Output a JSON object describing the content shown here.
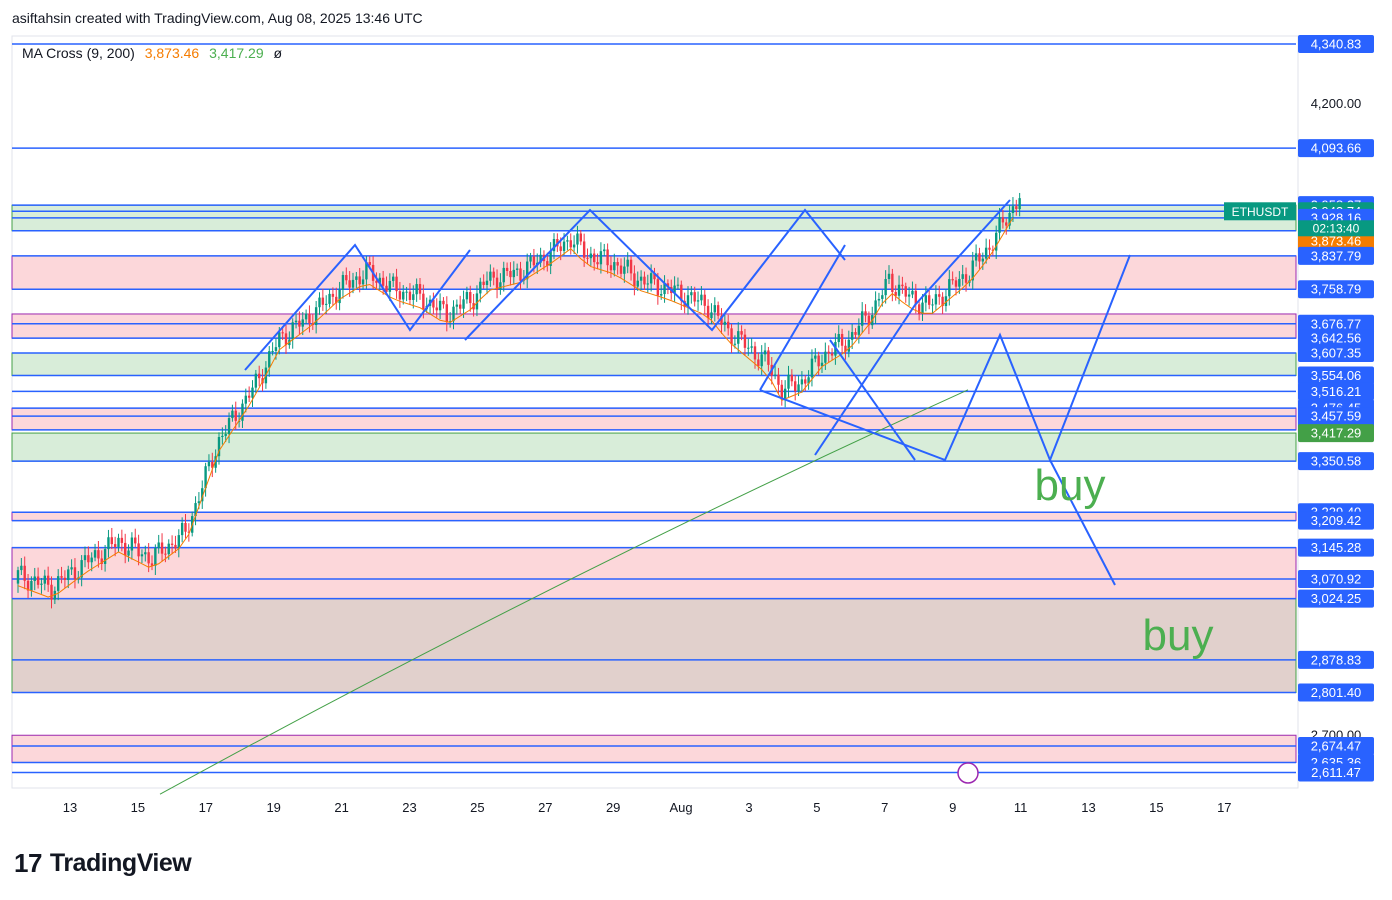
{
  "header": "asiftahsin created with TradingView.com, Aug 08, 2025 13:46 UTC",
  "indicator": {
    "name": "MA Cross (9, 200)",
    "fast": "3,873.46",
    "slow": "3,417.29",
    "eye": "ø"
  },
  "symbol": "ETHUSDT",
  "countdown": "02:13:40",
  "logo_text": "TradingView",
  "colors": {
    "up": "#089981",
    "down": "#f23645",
    "level_line": "#2962ff",
    "ma_fast": "#f57c00",
    "ma_slow": "#43a047",
    "buy_text": "#4caf50"
  },
  "chart_data": {
    "type": "candlestick",
    "y_axis_labels": [
      "4,340.83",
      "4,200.00",
      "4,093.66",
      "3,958.27",
      "3,943.74",
      "3,928.16",
      "3,897.47",
      "3,873.46",
      "3,837.79",
      "3,758.79",
      "3,676.77",
      "3,642.56",
      "3,607.35",
      "3,554.06",
      "3,516.21",
      "3,476.45",
      "3,457.59",
      "3,424.82",
      "3,417.29",
      "3,350.58",
      "3,229.40",
      "3,209.42",
      "3,145.28",
      "3,070.92",
      "3,024.25",
      "2,878.83",
      "2,801.40",
      "2,700.00",
      "2,674.47",
      "2,635.36",
      "2,611.47"
    ],
    "x_axis_labels": [
      "13",
      "15",
      "17",
      "19",
      "21",
      "23",
      "25",
      "27",
      "29",
      "Aug",
      "3",
      "5",
      "7",
      "9",
      "11",
      "13",
      "15",
      "17"
    ],
    "annotations": [
      "buy",
      "buy"
    ],
    "horizontal_levels": [
      4340.83,
      4093.66,
      3958.27,
      3943.74,
      3928.16,
      3897.47,
      3837.79,
      3758.79,
      3676.77,
      3642.56,
      3607.35,
      3554.06,
      3516.21,
      3476.45,
      3457.59,
      3424.82,
      3350.58,
      3229.4,
      3209.42,
      3145.28,
      3070.92,
      3024.25,
      2878.83,
      2801.4,
      2674.47,
      2635.36,
      2611.47
    ],
    "zones": [
      {
        "from": 3897.47,
        "to": 3958.27,
        "color": "green"
      },
      {
        "from": 3758.79,
        "to": 3837.79,
        "color": "red"
      },
      {
        "from": 3642.56,
        "to": 3700.0,
        "color": "red"
      },
      {
        "from": 3554.06,
        "to": 3607.35,
        "color": "green"
      },
      {
        "from": 3424.82,
        "to": 3476.45,
        "color": "red"
      },
      {
        "from": 3350.58,
        "to": 3417.29,
        "color": "green"
      },
      {
        "from": 3209.42,
        "to": 3229.4,
        "color": "red"
      },
      {
        "from": 3024.25,
        "to": 3145.28,
        "color": "red"
      },
      {
        "from": 2801.4,
        "to": 3024.25,
        "color": "brown"
      },
      {
        "from": 2635.36,
        "to": 2700.0,
        "color": "red"
      }
    ],
    "ma_fast_last": 3873.46,
    "ma_slow_last": 3417.29,
    "last_price": 3943.74
  }
}
